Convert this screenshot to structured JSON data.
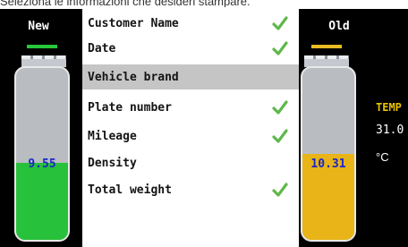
{
  "caption": "Seleziona le informazioni che desideri stampare.",
  "left_panel": {
    "title": "New",
    "value": "9.55",
    "fill_fraction": 0.45,
    "underline_color": "#27c83a",
    "fill_color": "#28c13b"
  },
  "right_panel": {
    "title": "Old",
    "value": "10.31",
    "fill_fraction": 0.5,
    "underline_color": "#e8bb24",
    "fill_color": "#e8b418"
  },
  "side_info": {
    "temp_label": "TEMP",
    "temp_value": "31.0",
    "temp_unit": "°C"
  },
  "list": {
    "items": [
      {
        "label": "Customer Name",
        "checked": true,
        "selected": false
      },
      {
        "label": "Date",
        "checked": true,
        "selected": false
      },
      {
        "label": "Vehicle brand",
        "checked": false,
        "selected": true
      },
      {
        "label": "Plate number",
        "checked": true,
        "selected": false
      },
      {
        "label": "Mileage",
        "checked": true,
        "selected": false
      },
      {
        "label": "Density",
        "checked": false,
        "selected": false
      },
      {
        "label": "Total weight",
        "checked": true,
        "selected": false
      }
    ],
    "check_icon": "check-icon",
    "check_color": "#5fb84a",
    "selected_color": "#c5c5c5"
  }
}
